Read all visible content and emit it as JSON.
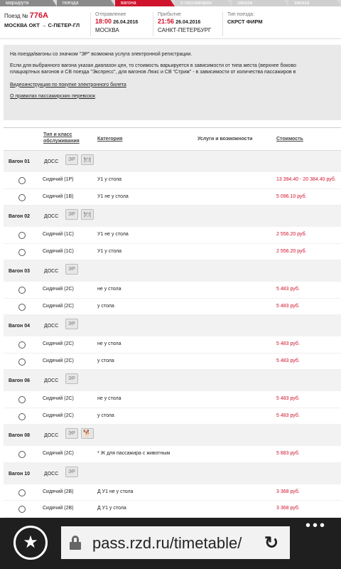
{
  "steps": [
    {
      "label": "маршрута",
      "state": "done"
    },
    {
      "label": "поезда",
      "state": "done"
    },
    {
      "label": "вагона",
      "state": "active"
    },
    {
      "label": "о пассажирах",
      "state": "todo"
    },
    {
      "label": "заказа",
      "state": "todo"
    },
    {
      "label": "заказа",
      "state": "todo"
    }
  ],
  "train": {
    "number_prefix": "Поезд №",
    "number": "776А",
    "route": "МОСКВА ОКТ → С-ПЕТЕР-ГЛ",
    "departure_label": "Отправление",
    "departure_time": "18:00",
    "departure_date": "26.04.2016",
    "departure_station": "МОСКВА",
    "arrival_label": "Прибытие",
    "arrival_time": "21:56",
    "arrival_date": "26.04.2016",
    "arrival_station": "САНКТ-ПЕТЕРБУРГ",
    "type_label": "Тип поезда:",
    "type_value": "СКРСТ ФИРМ"
  },
  "info": {
    "line1": "На поезда/вагоны со значком \"ЭР\" возможна услуга электронной регистрации.",
    "line2": "Если для выбранного вагона указан диапазон цен, то стоимость варьируется в зависимости от типа места (верхнее боково",
    "line3": "плацкартных вагонов и СВ поезда \"Экспресс\", для вагонов Люкс и СВ \"Стриж\" - в зависимости от количества пассажиров в",
    "link1": "Видеоинструкция по покупке электронного билета",
    "link2": "О правилах пассажирских перевозок"
  },
  "table": {
    "head": {
      "type_line1": "Тип и класс",
      "type_line2": "обслуживания",
      "category": "Категория",
      "services": "Услуги и возможности",
      "cost": "Стоимость"
    },
    "cars": [
      {
        "name": "Вагон 01",
        "cls": "ДОСС",
        "icons": [
          "ЭР",
          "food-icon"
        ],
        "seats": [
          {
            "type": "Сидячий (1Р)",
            "cat": "У1 у стола",
            "price": "13 394.40 - 20 384.40 руб."
          },
          {
            "type": "Сидячий (1В)",
            "cat": "У1 не у стола",
            "price": "5 096.10 руб."
          }
        ]
      },
      {
        "name": "Вагон 02",
        "cls": "ДОСС",
        "icons": [
          "ЭР",
          "food-icon"
        ],
        "seats": [
          {
            "type": "Сидячий (1С)",
            "cat": "У1 не у стола",
            "price": "2 556.20 руб."
          },
          {
            "type": "Сидячий (1С)",
            "cat": "У1 у стола",
            "price": "2 556.20 руб."
          }
        ]
      },
      {
        "name": "Вагон 03",
        "cls": "ДОСС",
        "icons": [
          "ЭР"
        ],
        "seats": [
          {
            "type": "Сидячий (2С)",
            "cat": "не у стола",
            "price": "5 483 руб."
          },
          {
            "type": "Сидячий (2С)",
            "cat": "у стола",
            "price": "5 483 руб."
          }
        ]
      },
      {
        "name": "Вагон 04",
        "cls": "ДОСС",
        "icons": [
          "ЭР"
        ],
        "seats": [
          {
            "type": "Сидячий (2С)",
            "cat": "не у стола",
            "price": "5 483 руб."
          },
          {
            "type": "Сидячий (2С)",
            "cat": "у стола",
            "price": "5 483 руб."
          }
        ]
      },
      {
        "name": "Вагон 06",
        "cls": "ДОСС",
        "icons": [
          "ЭР"
        ],
        "seats": [
          {
            "type": "Сидячий (2С)",
            "cat": "не у стола",
            "price": "5 483 руб."
          },
          {
            "type": "Сидячий (2С)",
            "cat": "у стола",
            "price": "5 483 руб."
          }
        ]
      },
      {
        "name": "Вагон 08",
        "cls": "ДОСС",
        "icons": [
          "ЭР",
          "dog-icon"
        ],
        "seats": [
          {
            "type": "Сидячий (2С)",
            "cat": "* Ж для пассажира с животным",
            "price": "5 883 руб."
          }
        ]
      },
      {
        "name": "Вагон 10",
        "cls": "ДОСС",
        "icons": [
          "ЭР"
        ],
        "seats": [
          {
            "type": "Сидячий (2В)",
            "cat": "Д У1 не у стола",
            "price": "3 368 руб."
          },
          {
            "type": "Сидячий (2В)",
            "cat": "Д У1 у стола",
            "price": "3 368 руб."
          }
        ]
      }
    ]
  },
  "browser": {
    "url": "pass.rzd.ru/timetable/",
    "favorite_icon": "star-icon",
    "lock_icon": "lock-icon",
    "reload_icon": "reload-icon",
    "more_icon": "more-icon",
    "more_glyph": "•••"
  }
}
